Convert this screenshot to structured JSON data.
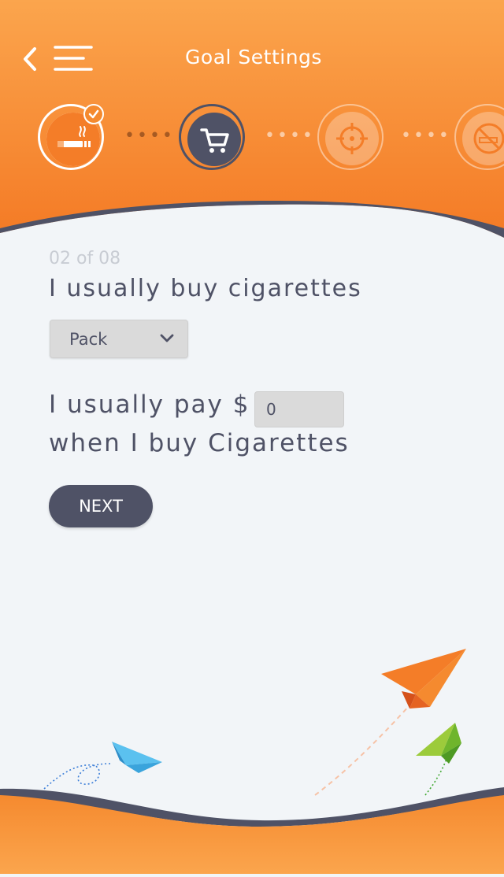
{
  "header": {
    "title": "Goal Settings",
    "back_icon": "chevron-left-icon",
    "menu_icon": "hamburger-menu-icon",
    "colors": {
      "orange_top": "#fba54d",
      "orange_bottom": "#f47a25",
      "navy": "#4f5266"
    }
  },
  "steps": [
    {
      "icon": "cigarette-icon",
      "status": "completed"
    },
    {
      "icon": "shopping-cart-icon",
      "status": "current"
    },
    {
      "icon": "target-icon",
      "status": "upcoming"
    },
    {
      "icon": "no-smoking-icon",
      "status": "upcoming"
    }
  ],
  "form": {
    "step_counter": "02 of 08",
    "question_buy": "I usually buy cigarettes",
    "buy_unit_selected": "Pack",
    "question_pay_prefix": "I usually pay $",
    "amount_value": "0",
    "question_pay_suffix": "when I buy Cigarettes",
    "next_label": "NEXT"
  }
}
